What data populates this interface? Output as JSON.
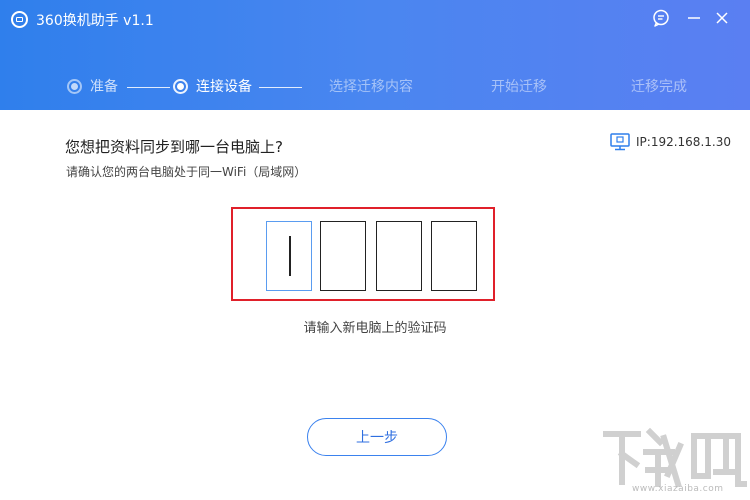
{
  "window": {
    "title": "360换机助手 v1.1",
    "logo_icon": "phone-swap-logo-icon",
    "controls": [
      "feedback-icon",
      "minimize-icon",
      "close-icon"
    ]
  },
  "steps": [
    {
      "label": "准备",
      "state": "done"
    },
    {
      "label": "连接设备",
      "state": "active"
    },
    {
      "label": "选择迁移内容",
      "state": "pending"
    },
    {
      "label": "开始迁移",
      "state": "pending"
    },
    {
      "label": "迁移完成",
      "state": "pending"
    }
  ],
  "main": {
    "question": "您想把资料同步到哪一台电脑上?",
    "subtext": "请确认您的两台电脑处于同一WiFi（局域网）",
    "ip_label": "IP:192.168.1.30",
    "ip_icon": "network-icon",
    "code": {
      "digits": [
        "",
        "",
        "",
        ""
      ],
      "focused_index": 0,
      "hint": "请输入新电脑上的验证码"
    },
    "back_button": "上一步"
  },
  "watermark": {
    "text": "下载吧",
    "url": "www.xiazaiba.com"
  },
  "colors": {
    "header_gradient_start": "#2f7fec",
    "header_gradient_end": "#5a7ff2",
    "highlight_border": "#e0202a",
    "button_border": "#3b82ee",
    "focused_box_border": "#5a9cf0"
  }
}
